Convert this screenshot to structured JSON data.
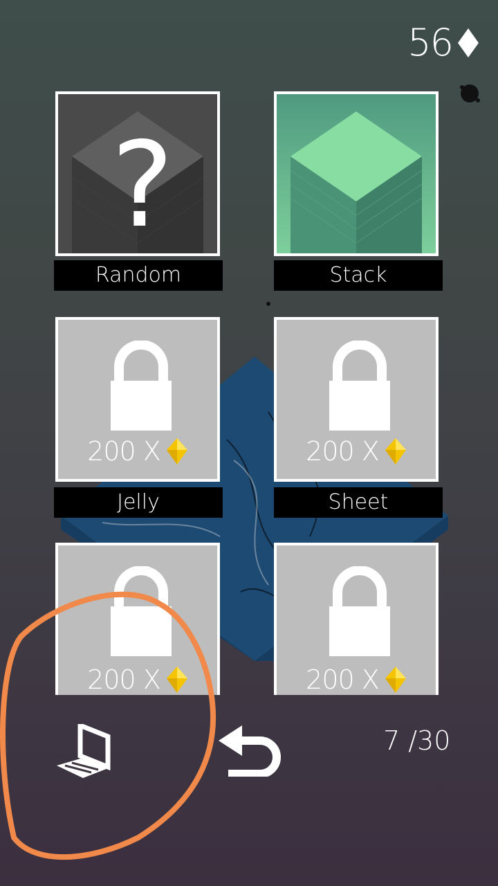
{
  "currency": {
    "count": "56",
    "icon": "diamond-icon"
  },
  "tiles": [
    {
      "name": "Random",
      "locked": false
    },
    {
      "name": "Stack",
      "locked": false
    },
    {
      "name": "Jelly",
      "locked": true,
      "price": "200 X"
    },
    {
      "name": "Sheet",
      "locked": true,
      "price": "200 X"
    },
    {
      "name": "",
      "locked": true,
      "price": "200 X"
    },
    {
      "name": "",
      "locked": true,
      "price": "200 X"
    }
  ],
  "pagination": "7 /30",
  "colors": {
    "accent_gem": "#f5c400",
    "annotation": "#f0894a"
  }
}
